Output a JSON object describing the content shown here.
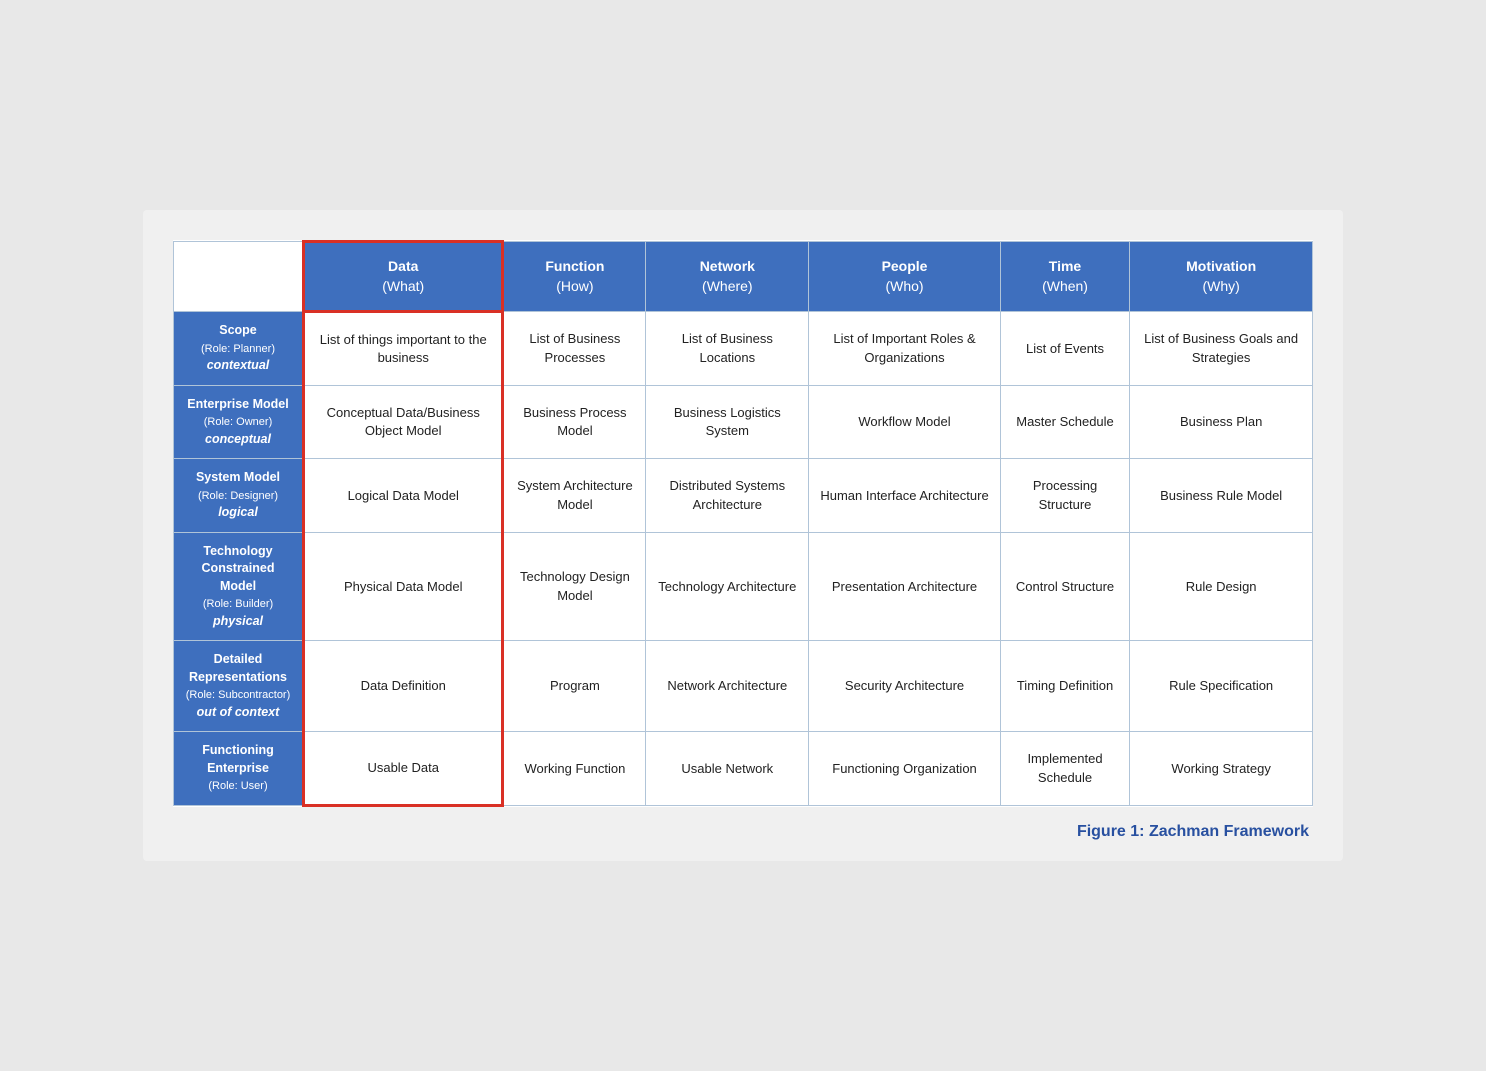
{
  "caption": "Figure 1: Zachman Framework",
  "headers": [
    {
      "id": "empty",
      "label": "",
      "sub": ""
    },
    {
      "id": "data",
      "label": "Data",
      "sub": "(What)"
    },
    {
      "id": "function",
      "label": "Function",
      "sub": "(How)"
    },
    {
      "id": "network",
      "label": "Network",
      "sub": "(Where)"
    },
    {
      "id": "people",
      "label": "People",
      "sub": "(Who)"
    },
    {
      "id": "time",
      "label": "Time",
      "sub": "(When)"
    },
    {
      "id": "motivation",
      "label": "Motivation",
      "sub": "(Why)"
    }
  ],
  "rows": [
    {
      "rowHeader": {
        "title": "Scope",
        "role": "(Role: Planner)",
        "sub": "contextual"
      },
      "cells": [
        "List of things important to the business",
        "List of Business Processes",
        "List of Business Locations",
        "List of Important Roles & Organizations",
        "List of Events",
        "List of Business Goals and Strategies"
      ]
    },
    {
      "rowHeader": {
        "title": "Enterprise Model",
        "role": "(Role: Owner)",
        "sub": "conceptual"
      },
      "cells": [
        "Conceptual Data/Business Object Model",
        "Business Process Model",
        "Business Logistics System",
        "Workflow Model",
        "Master Schedule",
        "Business Plan"
      ]
    },
    {
      "rowHeader": {
        "title": "System Model",
        "role": "(Role: Designer)",
        "sub": "logical"
      },
      "cells": [
        "Logical Data Model",
        "System Architecture Model",
        "Distributed Systems Architecture",
        "Human Interface Architecture",
        "Processing Structure",
        "Business Rule Model"
      ]
    },
    {
      "rowHeader": {
        "title": "Technology Constrained Model",
        "role": "(Role: Builder)",
        "sub": "physical"
      },
      "cells": [
        "Physical Data Model",
        "Technology Design Model",
        "Technology Architecture",
        "Presentation Architecture",
        "Control Structure",
        "Rule Design"
      ]
    },
    {
      "rowHeader": {
        "title": "Detailed Representations",
        "role": "(Role: Subcontractor)",
        "sub": "out of context"
      },
      "cells": [
        "Data Definition",
        "Program",
        "Network Architecture",
        "Security Architecture",
        "Timing Definition",
        "Rule Specification"
      ]
    },
    {
      "rowHeader": {
        "title": "Functioning Enterprise",
        "role": "(Role: User)",
        "sub": ""
      },
      "cells": [
        "Usable Data",
        "Working Function",
        "Usable Network",
        "Functioning Organization",
        "Implemented Schedule",
        "Working Strategy"
      ]
    }
  ]
}
